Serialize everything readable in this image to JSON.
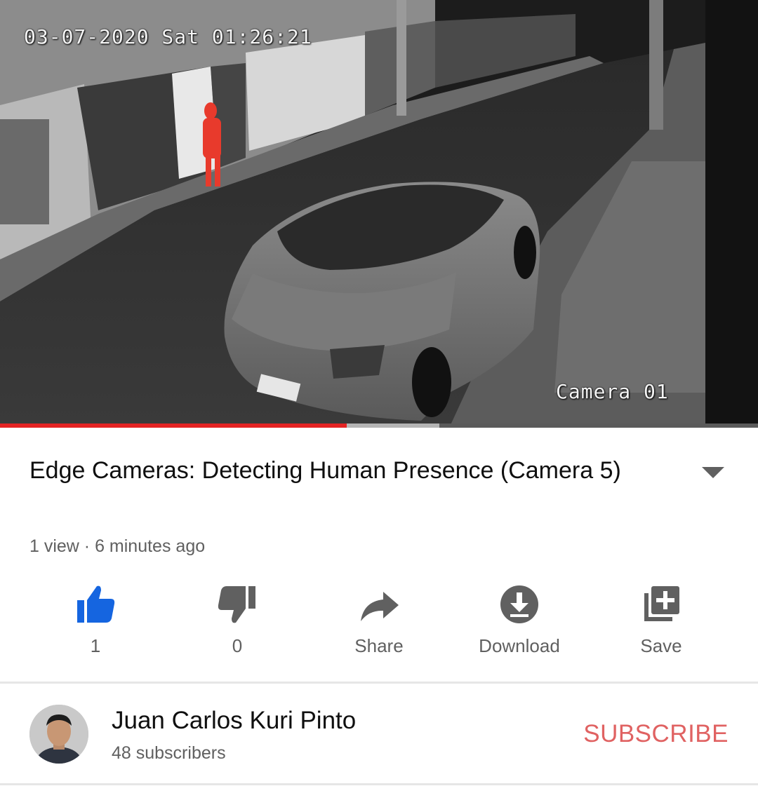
{
  "player": {
    "timestamp_overlay": "03-07-2020 Sat 01:26:21",
    "camera_overlay": "Camera 01",
    "progress_played": 0.457,
    "progress_buffered": 0.58,
    "colors": {
      "played": "#e32323",
      "buffered": "#b5b5b5",
      "track": "#5a5a5a"
    }
  },
  "video": {
    "title": "Edge Cameras: Detecting Human Presence (Camera 5)",
    "meta": "1 view · 6 minutes ago"
  },
  "actions": [
    {
      "label": "1",
      "icon": "thumbs-up-icon",
      "active": true,
      "color": "#1565e0"
    },
    {
      "label": "0",
      "icon": "thumbs-down-icon",
      "active": false,
      "color": "#606060"
    },
    {
      "label": "Share",
      "icon": "share-icon",
      "active": false,
      "color": "#606060"
    },
    {
      "label": "Download",
      "icon": "download-icon",
      "active": false,
      "color": "#606060"
    },
    {
      "label": "Save",
      "icon": "add-to-playlist-icon",
      "active": false,
      "color": "#606060"
    }
  ],
  "channel": {
    "name": "Juan Carlos Kuri Pinto",
    "subscribers": "48 subscribers",
    "subscribe_label": "SUBSCRIBE",
    "subscribe_color": "#e06262"
  }
}
